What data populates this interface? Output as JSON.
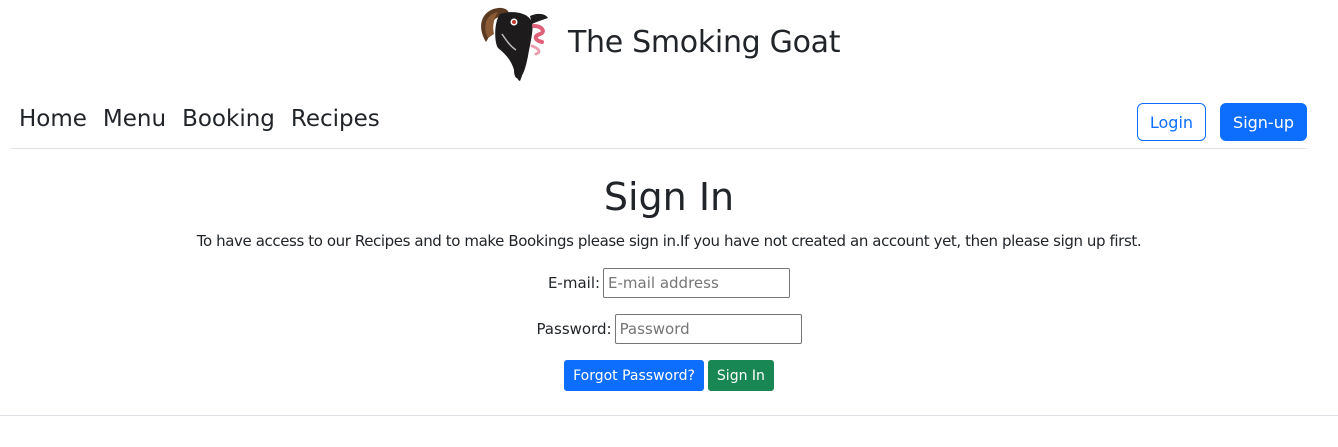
{
  "header": {
    "brand_title": "The Smoking Goat",
    "logo_icon": "goat-logo-icon"
  },
  "nav": {
    "links": [
      {
        "label": "Home"
      },
      {
        "label": "Menu"
      },
      {
        "label": "Booking"
      },
      {
        "label": "Recipes"
      }
    ],
    "login_label": "Login",
    "signup_label": "Sign-up"
  },
  "main": {
    "title": "Sign In",
    "intro": "To have access to our Recipes and to make Bookings please sign in.If you have not created an account yet, then please sign up first.",
    "email_label": "E-mail:",
    "email_placeholder": "E-mail address",
    "email_value": "",
    "password_label": "Password:",
    "password_placeholder": "Password",
    "password_value": "",
    "forgot_label": "Forgot Password?",
    "signin_label": "Sign In"
  },
  "colors": {
    "primary": "#0d6efd",
    "success": "#198754",
    "text": "#212529",
    "divider": "#dee2e6"
  }
}
